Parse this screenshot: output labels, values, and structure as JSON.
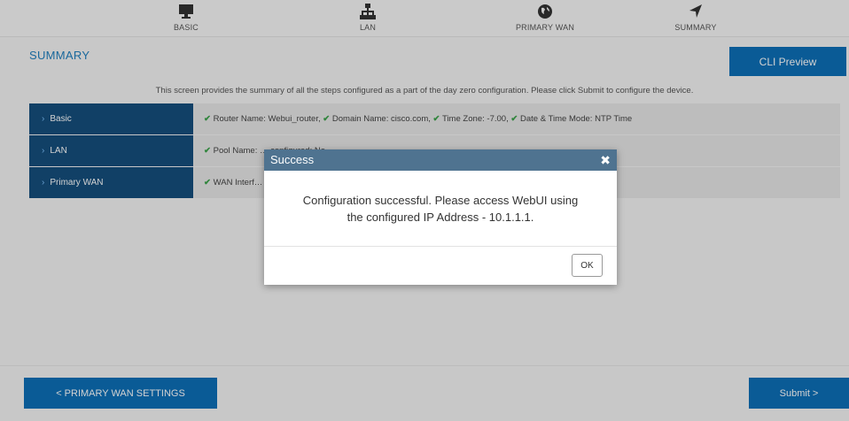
{
  "wizard": {
    "steps": [
      {
        "label": "BASIC",
        "icon": "monitor-icon"
      },
      {
        "label": "LAN",
        "icon": "network-icon"
      },
      {
        "label": "PRIMARY WAN",
        "icon": "globe-icon"
      },
      {
        "label": "SUMMARY",
        "icon": "location-arrow-icon"
      }
    ]
  },
  "summary": {
    "title": "SUMMARY",
    "cli_button": "CLI Preview",
    "intro": "This screen provides the summary of all the steps configured as a part of the day zero configuration. Please click Submit to configure the device.",
    "rows": [
      {
        "label": "Basic",
        "text": "✔ Router Name: Webui_router, ✔ Domain Name: cisco.com, ✔ Time Zone: -7.00, ✔ Date & Time Mode: NTP Time"
      },
      {
        "label": "LAN",
        "text": "✔ Pool Name: … configured: No"
      },
      {
        "label": "Primary WAN",
        "text": "✔ WAN Interf… P Time, ✔ NAT: Enabled, ✕ PPPoE: Disabled"
      }
    ]
  },
  "footer": {
    "prev_button": "< PRIMARY WAN SETTINGS",
    "submit_button": "Submit >"
  },
  "modal": {
    "title": "Success",
    "close": "✖",
    "message_line1": "Configuration successful. Please access WebUI using",
    "message_line2": "the configured IP Address - 10.1.1.1.",
    "ok_button": "OK"
  },
  "colors": {
    "accent": "#0d6fb7",
    "row_header": "#154f7d",
    "modal_header": "#4f7390",
    "check": "#3ba34a"
  }
}
